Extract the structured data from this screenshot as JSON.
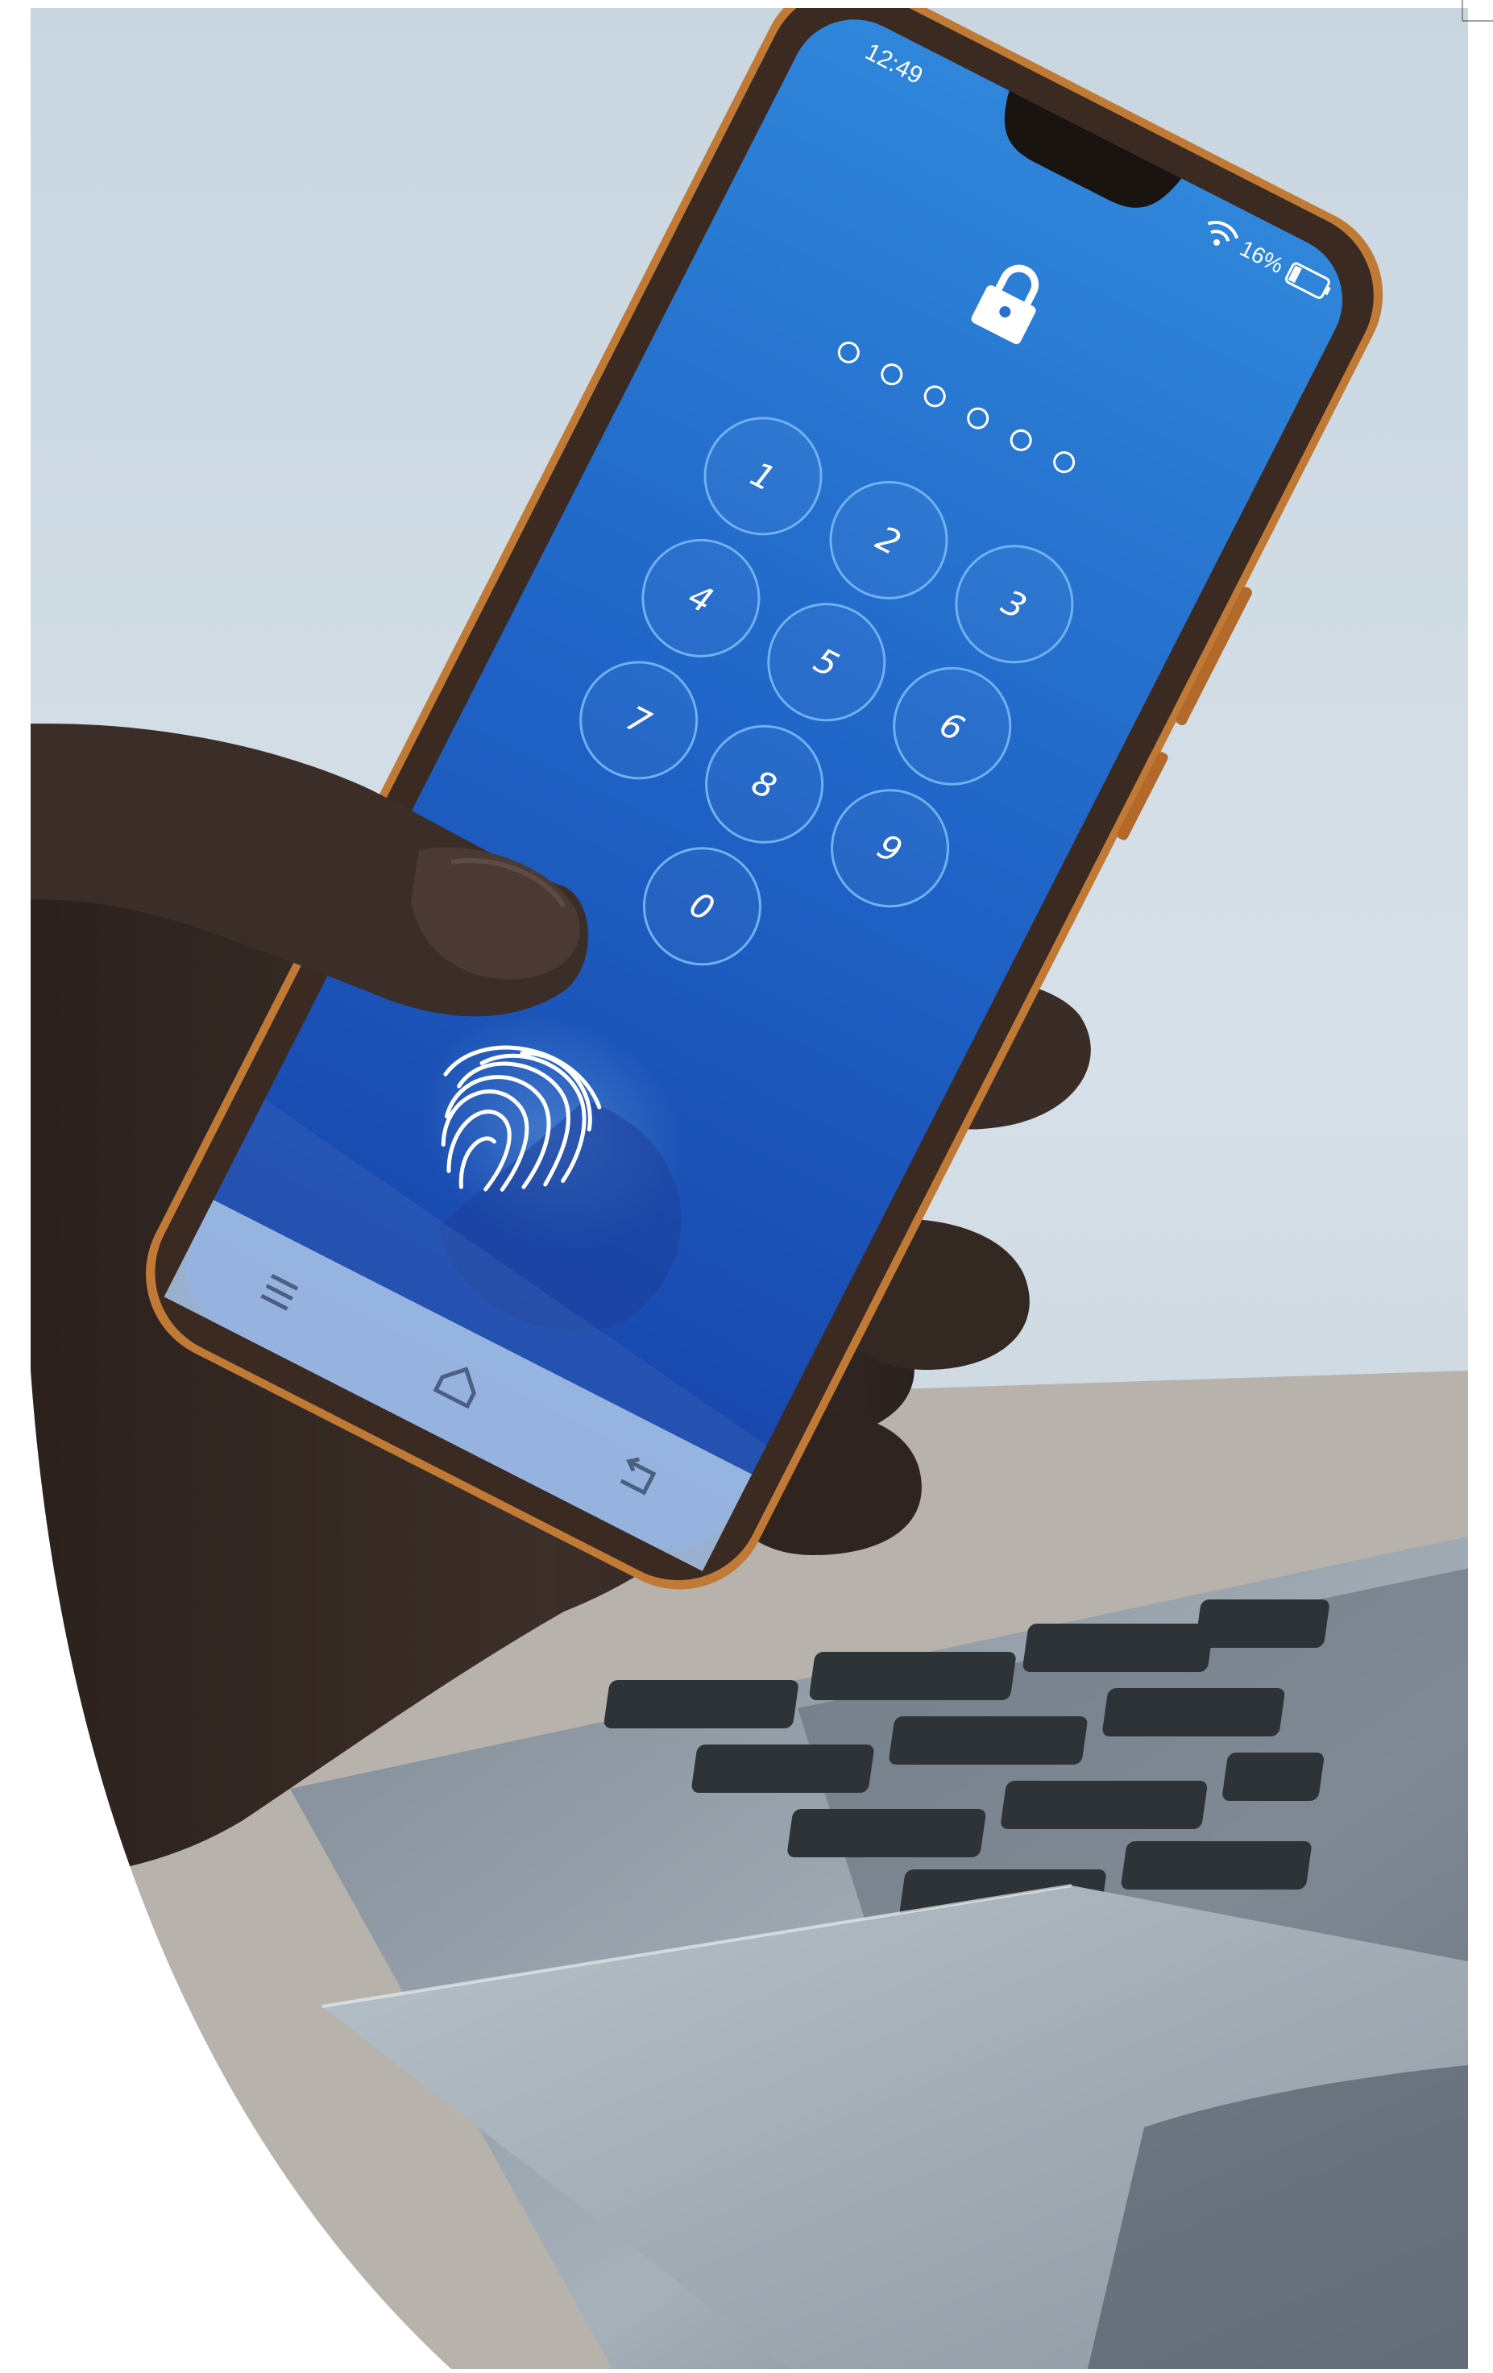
{
  "photo": {
    "subject": "hand-holding-smartphone-over-laptop",
    "colors": {
      "page_background": "#ffffff",
      "sky": "#cfdae3",
      "screen_top": "#2f82d8",
      "screen_bottom": "#1747b0",
      "phone_frame": "#3a2a22",
      "phone_rim": "#c07a35",
      "skin": "#3a2a24",
      "laptop": "#8a96a1",
      "key": "#2e3338"
    }
  },
  "phone": {
    "status_bar": {
      "time": "12:49",
      "battery": "16%",
      "wifi_icon": "wifi-icon",
      "battery_icon": "battery-icon"
    },
    "lock_screen": {
      "lock_icon": "padlock-icon",
      "pin_dots_total": 6,
      "pin_dots_filled": 0,
      "keypad": [
        {
          "label": "1"
        },
        {
          "label": "2"
        },
        {
          "label": "3"
        },
        {
          "label": "4"
        },
        {
          "label": "5"
        },
        {
          "label": "6"
        },
        {
          "label": "7"
        },
        {
          "label": "8"
        },
        {
          "label": "9"
        },
        {
          "label": "0"
        }
      ],
      "fingerprint_icon": "fingerprint-icon"
    },
    "nav_bar": {
      "menu_icon": "menu-icon",
      "home_icon": "home-icon",
      "back_icon": "back-icon"
    }
  }
}
